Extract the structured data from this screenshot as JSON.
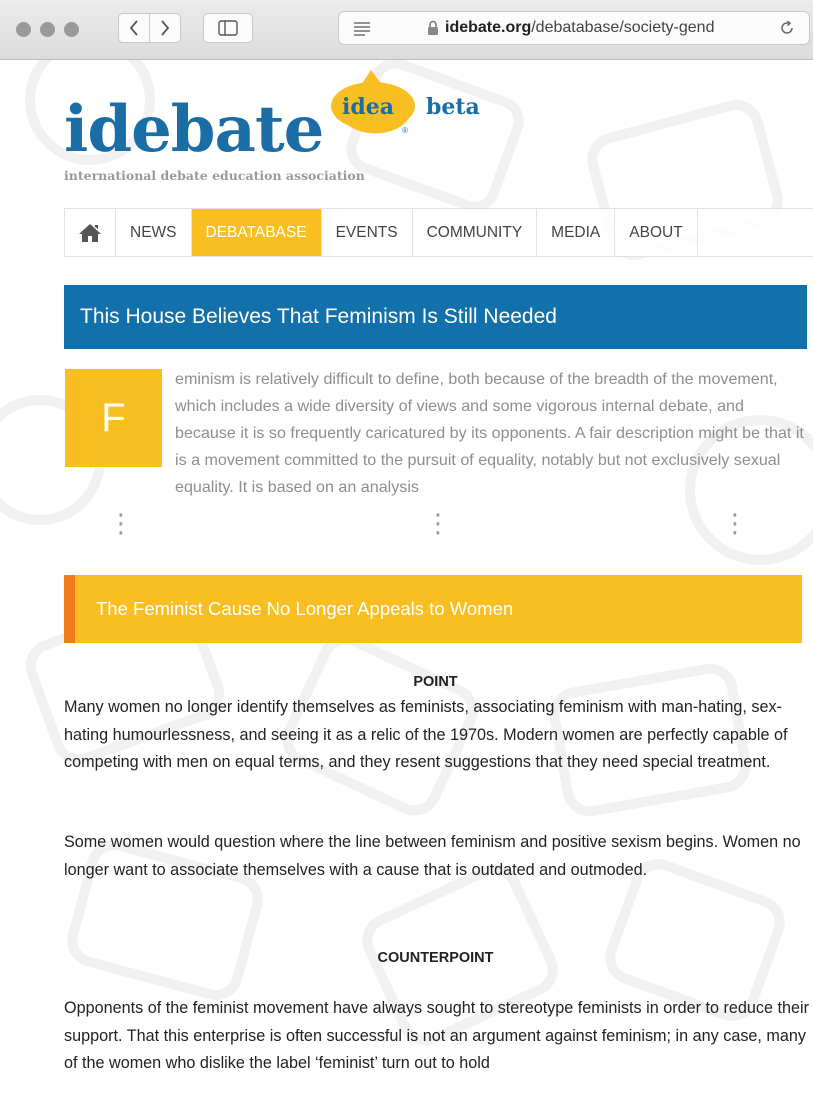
{
  "browser": {
    "url_domain": "idebate.org",
    "url_path": "/debatabase/society-gend"
  },
  "logo": {
    "main": "idebate",
    "bubble": "idea",
    "beta": "beta",
    "registered": "®",
    "subtitle": "international debate education association"
  },
  "nav": {
    "items": [
      "NEWS",
      "DEBATABASE",
      "EVENTS",
      "COMMUNITY",
      "MEDIA",
      "ABOUT"
    ],
    "active": "DEBATABASE"
  },
  "page_title": "This House Believes That Feminism Is Still Needed",
  "intro": {
    "dropcap": "F",
    "text": "eminism is relatively difficult to define, both because of the breadth of the movement, which includes a wide diversity of views and some vigorous internal debate, and because it is so frequently caricatured by its opponents. A fair description might be that it is a movement committed to the pursuit of equality, notably but not exclusively sexual equality. It is based on an analysis",
    "more": "⋮"
  },
  "argument": {
    "title": "The Feminist Cause No Longer Appeals to Women",
    "point_heading": "POINT",
    "point_paragraphs": [
      "Many women no longer identify themselves as feminists, associating feminism with man-hating, sex-hating humourlessness, and seeing it as a relic of the 1970s. Modern women are perfectly capable of competing with men on equal terms, and they resent suggestions that they need special treatment.",
      "Some women would question where the line between feminism and positive sexism begins. Women no longer want to associate themselves with a cause that is outdated and outmoded."
    ],
    "counterpoint_heading": "COUNTERPOINT",
    "counterpoint_paragraphs": [
      "Opponents of the feminist movement have always sought to stereotype feminists in order to reduce their support. That this enterprise is often successful is not an argument against feminism; in any case, many of the women who dislike the label ‘feminist’ turn out to hold"
    ]
  },
  "colors": {
    "brand_blue": "#1270ab",
    "brand_yellow": "#f9bf22",
    "accent_orange": "#f07d1c"
  },
  "icons": {
    "home": "home-icon",
    "back": "chevron-left-icon",
    "forward": "chevron-right-icon",
    "sidebar": "sidebar-icon",
    "reader": "reader-icon",
    "lock": "lock-icon",
    "reload": "reload-icon"
  }
}
